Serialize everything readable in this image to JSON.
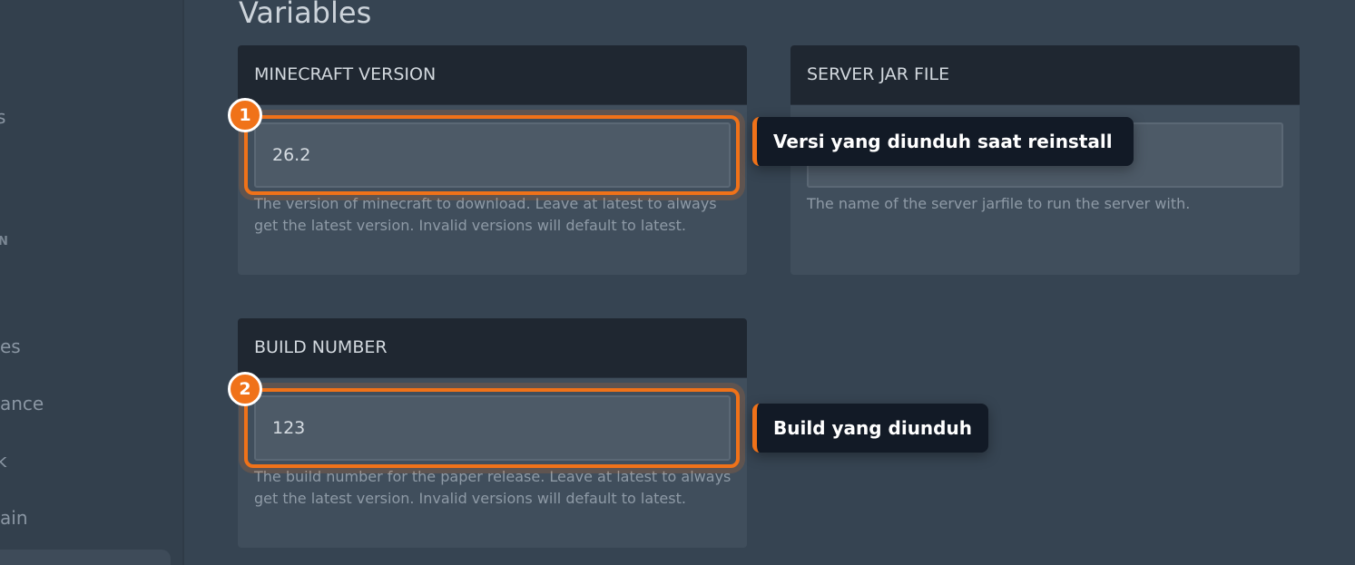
{
  "sidebar": {
    "fragments": [
      "s",
      "N",
      "es",
      "ance",
      "k",
      "ain"
    ]
  },
  "page": {
    "title": "Variables"
  },
  "variables": [
    {
      "name": "MINECRAFT VERSION",
      "value": "26.2",
      "description": "The version of minecraft to download. Leave at latest to always get the latest version. Invalid versions will default to latest."
    },
    {
      "name": "SERVER JAR FILE",
      "value": "",
      "description": "The name of the server jarfile to run the server with."
    },
    {
      "name": "BUILD NUMBER",
      "value": "123",
      "description": "The build number for the paper release. Leave at latest to always get the latest version. Invalid versions will default to latest."
    }
  ],
  "annotations": [
    {
      "number": "1",
      "text": "Versi yang diunduh saat reinstall"
    },
    {
      "number": "2",
      "text": "Build yang diunduh"
    }
  ],
  "colors": {
    "accent": "#f07219",
    "background": "#364452",
    "card_header": "#1f2731",
    "tooltip": "#121a26"
  }
}
